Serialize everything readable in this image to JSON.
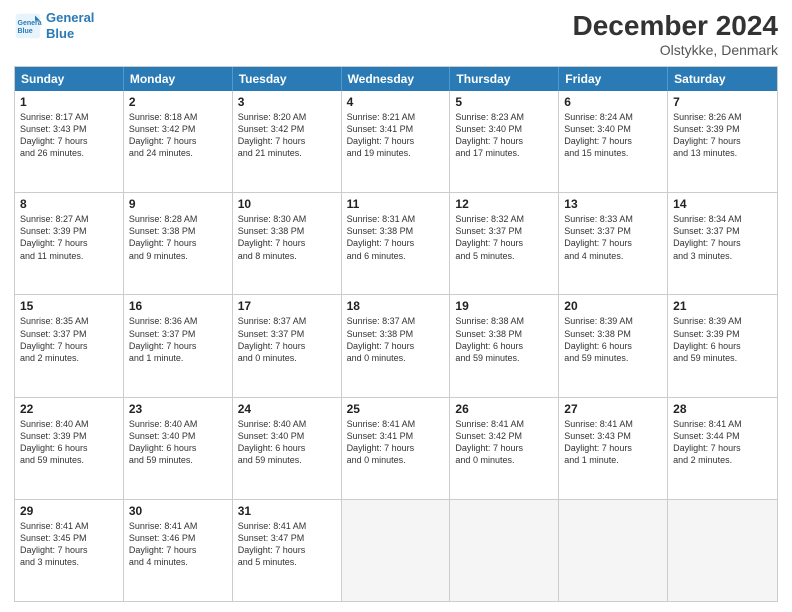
{
  "header": {
    "logo_line1": "General",
    "logo_line2": "Blue",
    "month": "December 2024",
    "location": "Olstykke, Denmark"
  },
  "weekdays": [
    "Sunday",
    "Monday",
    "Tuesday",
    "Wednesday",
    "Thursday",
    "Friday",
    "Saturday"
  ],
  "weeks": [
    [
      {
        "day": "1",
        "info": "Sunrise: 8:17 AM\nSunset: 3:43 PM\nDaylight: 7 hours\nand 26 minutes."
      },
      {
        "day": "2",
        "info": "Sunrise: 8:18 AM\nSunset: 3:42 PM\nDaylight: 7 hours\nand 24 minutes."
      },
      {
        "day": "3",
        "info": "Sunrise: 8:20 AM\nSunset: 3:42 PM\nDaylight: 7 hours\nand 21 minutes."
      },
      {
        "day": "4",
        "info": "Sunrise: 8:21 AM\nSunset: 3:41 PM\nDaylight: 7 hours\nand 19 minutes."
      },
      {
        "day": "5",
        "info": "Sunrise: 8:23 AM\nSunset: 3:40 PM\nDaylight: 7 hours\nand 17 minutes."
      },
      {
        "day": "6",
        "info": "Sunrise: 8:24 AM\nSunset: 3:40 PM\nDaylight: 7 hours\nand 15 minutes."
      },
      {
        "day": "7",
        "info": "Sunrise: 8:26 AM\nSunset: 3:39 PM\nDaylight: 7 hours\nand 13 minutes."
      }
    ],
    [
      {
        "day": "8",
        "info": "Sunrise: 8:27 AM\nSunset: 3:39 PM\nDaylight: 7 hours\nand 11 minutes."
      },
      {
        "day": "9",
        "info": "Sunrise: 8:28 AM\nSunset: 3:38 PM\nDaylight: 7 hours\nand 9 minutes."
      },
      {
        "day": "10",
        "info": "Sunrise: 8:30 AM\nSunset: 3:38 PM\nDaylight: 7 hours\nand 8 minutes."
      },
      {
        "day": "11",
        "info": "Sunrise: 8:31 AM\nSunset: 3:38 PM\nDaylight: 7 hours\nand 6 minutes."
      },
      {
        "day": "12",
        "info": "Sunrise: 8:32 AM\nSunset: 3:37 PM\nDaylight: 7 hours\nand 5 minutes."
      },
      {
        "day": "13",
        "info": "Sunrise: 8:33 AM\nSunset: 3:37 PM\nDaylight: 7 hours\nand 4 minutes."
      },
      {
        "day": "14",
        "info": "Sunrise: 8:34 AM\nSunset: 3:37 PM\nDaylight: 7 hours\nand 3 minutes."
      }
    ],
    [
      {
        "day": "15",
        "info": "Sunrise: 8:35 AM\nSunset: 3:37 PM\nDaylight: 7 hours\nand 2 minutes."
      },
      {
        "day": "16",
        "info": "Sunrise: 8:36 AM\nSunset: 3:37 PM\nDaylight: 7 hours\nand 1 minute."
      },
      {
        "day": "17",
        "info": "Sunrise: 8:37 AM\nSunset: 3:37 PM\nDaylight: 7 hours\nand 0 minutes."
      },
      {
        "day": "18",
        "info": "Sunrise: 8:37 AM\nSunset: 3:38 PM\nDaylight: 7 hours\nand 0 minutes."
      },
      {
        "day": "19",
        "info": "Sunrise: 8:38 AM\nSunset: 3:38 PM\nDaylight: 6 hours\nand 59 minutes."
      },
      {
        "day": "20",
        "info": "Sunrise: 8:39 AM\nSunset: 3:38 PM\nDaylight: 6 hours\nand 59 minutes."
      },
      {
        "day": "21",
        "info": "Sunrise: 8:39 AM\nSunset: 3:39 PM\nDaylight: 6 hours\nand 59 minutes."
      }
    ],
    [
      {
        "day": "22",
        "info": "Sunrise: 8:40 AM\nSunset: 3:39 PM\nDaylight: 6 hours\nand 59 minutes."
      },
      {
        "day": "23",
        "info": "Sunrise: 8:40 AM\nSunset: 3:40 PM\nDaylight: 6 hours\nand 59 minutes."
      },
      {
        "day": "24",
        "info": "Sunrise: 8:40 AM\nSunset: 3:40 PM\nDaylight: 6 hours\nand 59 minutes."
      },
      {
        "day": "25",
        "info": "Sunrise: 8:41 AM\nSunset: 3:41 PM\nDaylight: 7 hours\nand 0 minutes."
      },
      {
        "day": "26",
        "info": "Sunrise: 8:41 AM\nSunset: 3:42 PM\nDaylight: 7 hours\nand 0 minutes."
      },
      {
        "day": "27",
        "info": "Sunrise: 8:41 AM\nSunset: 3:43 PM\nDaylight: 7 hours\nand 1 minute."
      },
      {
        "day": "28",
        "info": "Sunrise: 8:41 AM\nSunset: 3:44 PM\nDaylight: 7 hours\nand 2 minutes."
      }
    ],
    [
      {
        "day": "29",
        "info": "Sunrise: 8:41 AM\nSunset: 3:45 PM\nDaylight: 7 hours\nand 3 minutes."
      },
      {
        "day": "30",
        "info": "Sunrise: 8:41 AM\nSunset: 3:46 PM\nDaylight: 7 hours\nand 4 minutes."
      },
      {
        "day": "31",
        "info": "Sunrise: 8:41 AM\nSunset: 3:47 PM\nDaylight: 7 hours\nand 5 minutes."
      },
      {
        "day": "",
        "info": ""
      },
      {
        "day": "",
        "info": ""
      },
      {
        "day": "",
        "info": ""
      },
      {
        "day": "",
        "info": ""
      }
    ]
  ]
}
